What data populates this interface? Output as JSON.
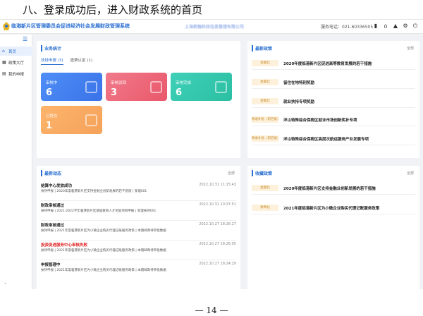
{
  "doc": {
    "heading": "八、登录成功后，进入财政系统的首页",
    "bullet": ".",
    "page_number": "— 14 —"
  },
  "header": {
    "app_title": "临港新片区管理委员会促进经济社会发展财政管理系统",
    "company": "上海新融科技信息管理有限公司",
    "hotline": "服务电话：021-60336505",
    "icons": [
      "book-icon",
      "home-icon",
      "bell-icon",
      "gear-icon",
      "power-icon"
    ]
  },
  "sidebar": {
    "items": [
      {
        "label": "首页",
        "icon": "home-icon",
        "active": true
      },
      {
        "label": "政策大厅",
        "icon": "grid-icon",
        "active": false
      },
      {
        "label": "我的申报",
        "icon": "doc-icon",
        "active": false
      }
    ]
  },
  "stats": {
    "title": "业务统计",
    "tabs": [
      {
        "label": "扶持申报 (3)",
        "active": true
      },
      {
        "label": "退费认定 (1)",
        "active": false
      }
    ],
    "tiles": [
      {
        "label": "审核中",
        "value": "6",
        "color": "#4f8ef7"
      },
      {
        "label": "审核驳回",
        "value": "3",
        "color": "#f07a8a"
      },
      {
        "label": "审核完成",
        "value": "6",
        "color": "#3fd0b8"
      },
      {
        "label": "已提交",
        "value": "1",
        "color": "#fdb46b"
      }
    ]
  },
  "policies": {
    "title": "最新政策",
    "more": "全部",
    "rows": [
      {
        "tag": "金雁北",
        "text": "2020年度临港新片区促进高等教育发展的若干措施"
      },
      {
        "tag": "金雁北",
        "text": "留住在地特别奖励"
      },
      {
        "tag": "金雁北",
        "text": "就业扶持专项奖励"
      },
      {
        "tag": "税收补贴（新区级）",
        "text": "洋山特殊综合保税区就业市场创新奖补专项"
      },
      {
        "tag": "税收补贴（新区级）",
        "text": "洋山特殊综合保税区高层次航运服务产业发展专项"
      }
    ]
  },
  "dynamics": {
    "title": "最新动态",
    "more": "全部",
    "items": [
      {
        "title": "结算中心发放成功",
        "date": "2022.10.31 11:15:43",
        "desc": "扶持申报 | 2020年度临港新片区支持金融业创新发展的若干措施 | 受理001",
        "red": false
      },
      {
        "title": "财政审核通过",
        "date": "2022.10.31 10:37:51",
        "desc": "扶持申报 | 2021-2022学年临港新片区基础教育人才奖励项目申报 | 受理扶持001",
        "red": false
      },
      {
        "title": "财政审核通过",
        "date": "2022.10.27 18:26:27",
        "desc": "扶持申报 | 2021年度临港新片区为小微企业购买代理记账服务政策 | 本期邮政待审批数据",
        "red": false
      },
      {
        "title": "投资促进服务中心审核失败",
        "date": "2022.10.27 18:26:05",
        "desc": "扶持申报 | 2021年度临港新片区为小微企业购买代理记账服务政策 | 本期邮政待审批数据",
        "red": true
      },
      {
        "title": "申报管理中",
        "date": "2022.10.27 18:24:29",
        "desc": "扶持申报 | 2021年度临港新片区为小微企业购买代理记账服务政策 | 本期邮政待审批数据",
        "red": false
      }
    ]
  },
  "favorites": {
    "title": "收藏政策",
    "more": "全部",
    "rows": [
      {
        "tag": "金雁北",
        "text": "2020年度临港新片区支持金融业创新发展的若干措施"
      },
      {
        "tag": "财政北",
        "text": "2021年度临港新片区为小微企业购买代理记账服务政策"
      }
    ]
  }
}
